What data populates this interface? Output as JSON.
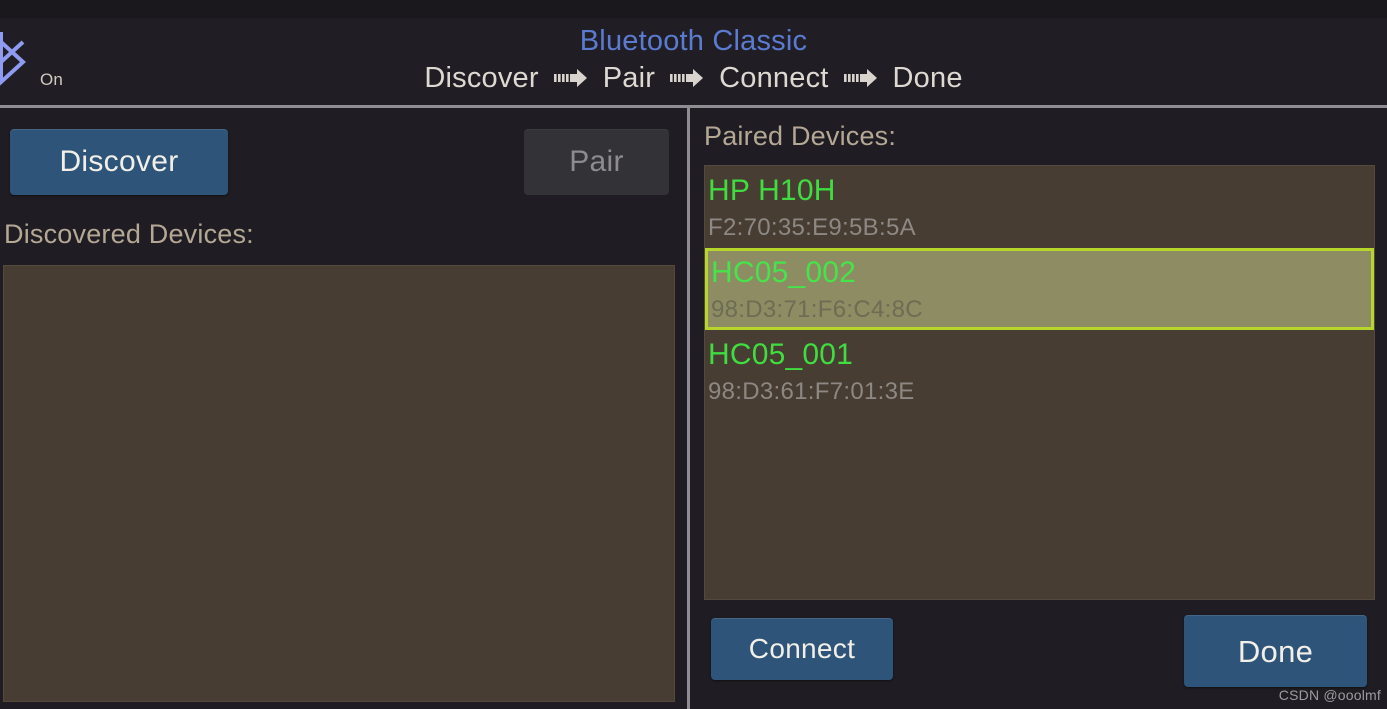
{
  "header": {
    "bluetooth_icon": "bluetooth-icon",
    "bluetooth_state": "On",
    "title": "Bluetooth Classic",
    "steps": [
      {
        "label": "Discover"
      },
      {
        "label": "Pair"
      },
      {
        "label": "Connect"
      },
      {
        "label": "Done"
      }
    ],
    "arrow_icon": "dashed-arrow-right-icon",
    "title_color": "#5b7bd0"
  },
  "left_panel": {
    "discover_button": "Discover",
    "pair_button": "Pair",
    "discovered_label": "Discovered Devices:",
    "discovered_devices": []
  },
  "right_panel": {
    "paired_label": "Paired Devices:",
    "paired_devices": [
      {
        "name": "HP H10H",
        "mac": "F2:70:35:E9:5B:5A",
        "selected": false
      },
      {
        "name": "HC05_002",
        "mac": "98:D3:71:F6:C4:8C",
        "selected": true
      },
      {
        "name": "HC05_001",
        "mac": "98:D3:61:F7:01:3E",
        "selected": false
      }
    ],
    "connect_button": "Connect",
    "done_button": "Done"
  },
  "watermark": "CSDN @ooolmf",
  "colors": {
    "accent_blue": "#2e5579",
    "title_blue": "#5b7bd0",
    "device_green": "#3fdd3f",
    "selection_border": "#b7d62b",
    "selection_fill": "#8e8c62",
    "list_background": "#473d32",
    "label_tan": "#b4a894",
    "page_background": "#1f1d23"
  }
}
